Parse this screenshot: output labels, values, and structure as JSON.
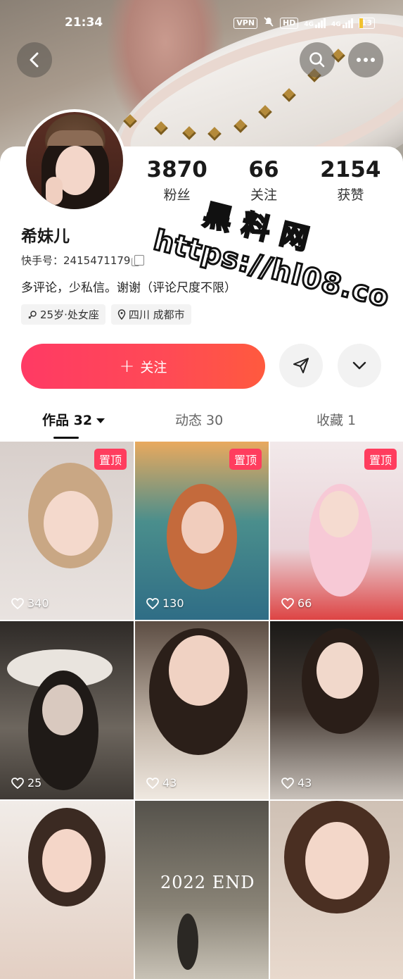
{
  "status_bar": {
    "time": "21:34",
    "vpn": "VPN",
    "hd": "HD",
    "net1": "4G",
    "net2": "4G",
    "battery": "13"
  },
  "profile": {
    "name": "希妹儿",
    "kid_label": "快手号：",
    "kid": "2415471179",
    "bio": "多评论，少私信。谢谢（评论尺度不限）",
    "tags": [
      {
        "icon": "gender-icon",
        "text": "25岁·处女座"
      },
      {
        "icon": "location-icon",
        "text": "四川 成都市"
      }
    ]
  },
  "stats": [
    {
      "value": "3870",
      "label": "粉丝"
    },
    {
      "value": "66",
      "label": "关注"
    },
    {
      "value": "2154",
      "label": "获赞"
    }
  ],
  "actions": {
    "follow_label": "关注"
  },
  "tabs": [
    {
      "label": "作品 32"
    },
    {
      "label": "动态 30"
    },
    {
      "label": "收藏 1"
    }
  ],
  "grid": [
    {
      "pinned": "置顶",
      "likes": "340"
    },
    {
      "pinned": "置顶",
      "likes": "130"
    },
    {
      "pinned": "置顶",
      "likes": "66"
    },
    {
      "pinned": "",
      "likes": "25"
    },
    {
      "pinned": "",
      "likes": "43"
    },
    {
      "pinned": "",
      "likes": "43"
    },
    {
      "pinned": "",
      "likes": ""
    },
    {
      "pinned": "",
      "likes": "",
      "overlay": "2022 END"
    },
    {
      "pinned": "",
      "likes": ""
    }
  ],
  "watermark": {
    "line1": "黑料网",
    "line2": "https://hl08.co"
  }
}
